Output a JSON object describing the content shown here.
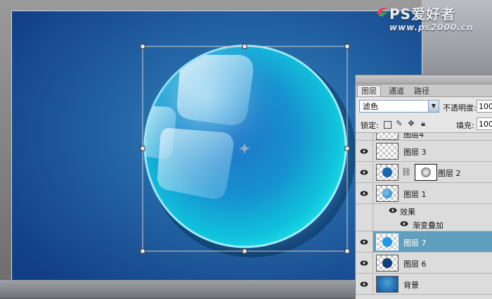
{
  "watermark": {
    "title": "PS爱好者",
    "url": "www.ps2000.cn"
  },
  "panel": {
    "tabs": [
      "图层",
      "通道",
      "路径"
    ],
    "blend_mode": "滤色",
    "opacity_label": "不透明度:",
    "opacity_value": "100",
    "lock_label": "锁定:",
    "lock_icons": [
      "transparency-lock-icon",
      "brush-lock-icon",
      "move-lock-icon",
      "padlock-icon"
    ],
    "fill_label": "填充:",
    "fill_value": "100",
    "layers": [
      {
        "name": "图层4",
        "partial": true
      },
      {
        "name": "图层 3"
      },
      {
        "name": "图层 2",
        "mask": true
      },
      {
        "name": "图层 1"
      },
      {
        "name": "效果",
        "sub": true
      },
      {
        "name": "渐变叠加",
        "sub": true
      },
      {
        "name": "图层 7",
        "selected": true
      },
      {
        "name": "图层 6"
      },
      {
        "name": "背景"
      }
    ]
  },
  "colors": {
    "canvas_dark": "#123f86",
    "canvas_light": "#3a8cc6",
    "orb_cyan": "#18d4e6",
    "selection_row": "#5f9fbd"
  }
}
